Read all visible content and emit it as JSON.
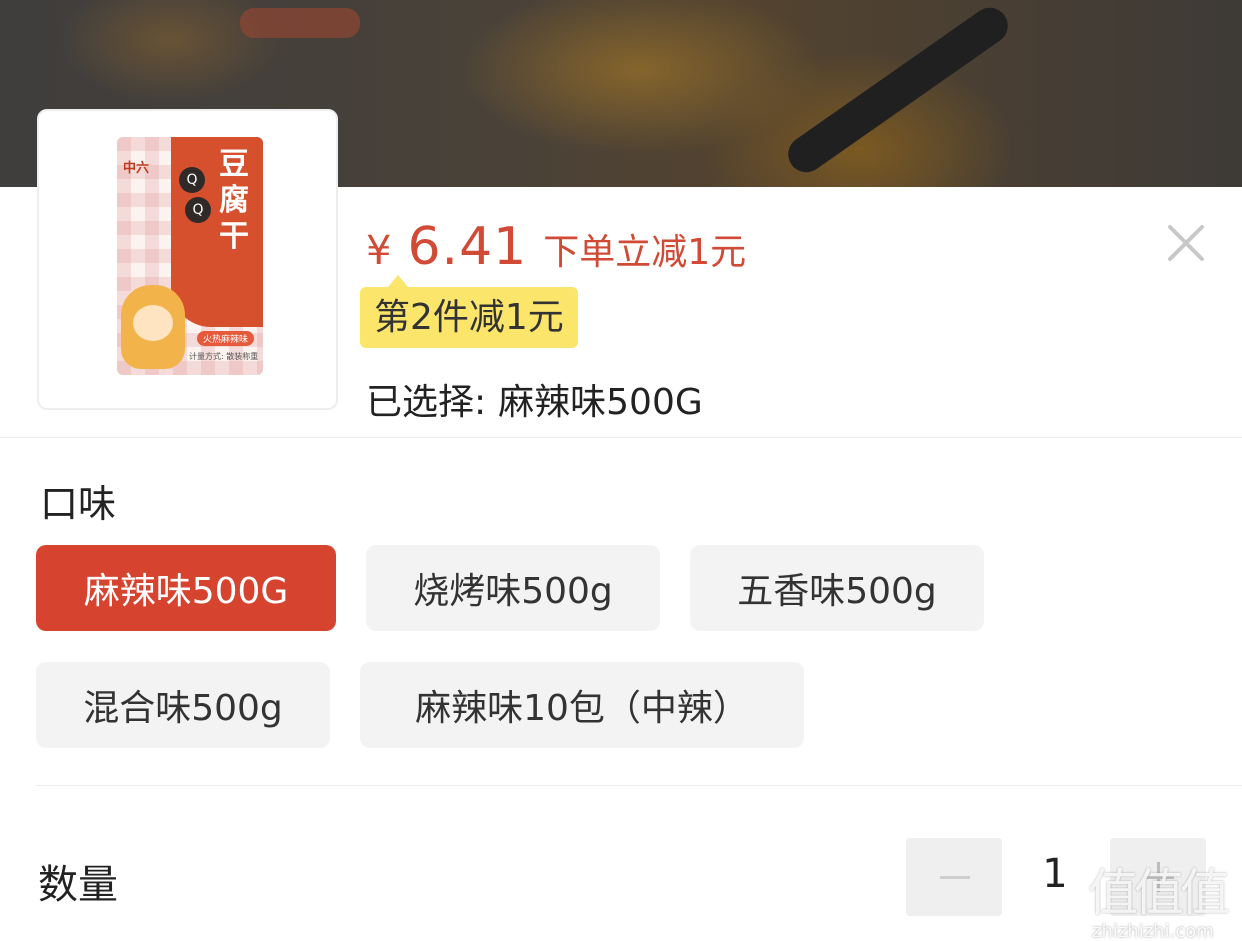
{
  "product": {
    "thumbnail": {
      "brand": "中六",
      "name_vertical": "豆腐干",
      "qq": "Q",
      "flavor": "火热麻辣味",
      "meta": "计量方式: 散装称重"
    },
    "price": {
      "currency": "¥",
      "amount": "6.41",
      "promo": "下单立减1元"
    },
    "coupon": "第2件减1元",
    "selected": {
      "label": "已选择:",
      "value": "麻辣味500G"
    }
  },
  "flavor_section": {
    "title": "口味",
    "options": [
      {
        "label": "麻辣味500G",
        "selected": true
      },
      {
        "label": "烧烤味500g",
        "selected": false
      },
      {
        "label": "五香味500g",
        "selected": false
      },
      {
        "label": "混合味500g",
        "selected": false
      },
      {
        "label": "麻辣味10包（中辣）",
        "selected": false
      }
    ]
  },
  "quantity": {
    "label": "数量",
    "value": "1"
  },
  "watermark": {
    "glyph": "值值值",
    "text": "zhizhizhi.com"
  },
  "colors": {
    "accent": "#d6432f",
    "price": "#d04a35",
    "coupon_bg": "#fbe56b",
    "option_bg": "#f3f3f3"
  },
  "icons": {
    "close": "close-icon",
    "minus": "minus-icon",
    "plus": "plus-icon"
  }
}
